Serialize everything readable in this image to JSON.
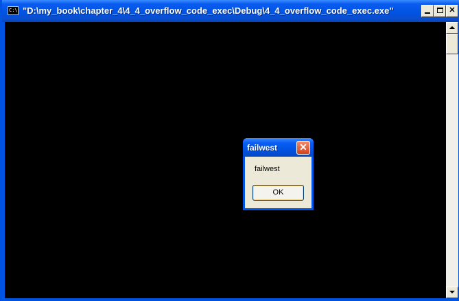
{
  "console_window": {
    "title": "\"D:\\my_book\\chapter_4\\4_4_overflow_code_exec\\Debug\\4_4_overflow_code_exec.exe\"",
    "icon_text": "C:\\",
    "icon": "console-icon",
    "close_glyph": "✕"
  },
  "message_box": {
    "title": "failwest",
    "message": "failwest",
    "ok_label": "OK",
    "close_glyph": "✕"
  },
  "colors": {
    "titlebar": "#0054e3",
    "console_background": "#000000",
    "dialog_background": "#ece9d8",
    "close_button": "#d4421c"
  }
}
